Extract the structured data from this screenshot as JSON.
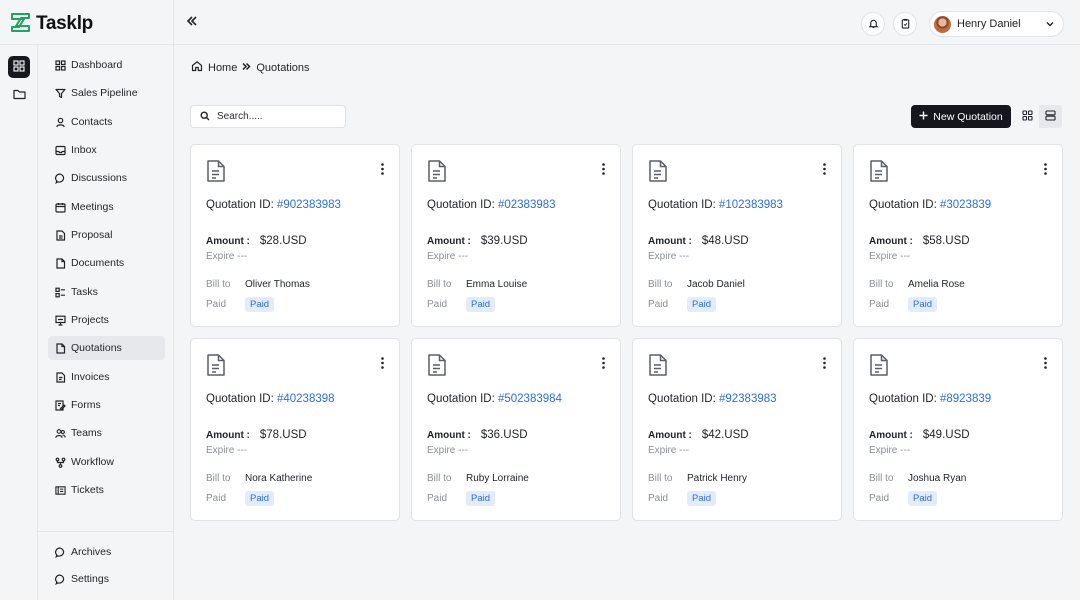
{
  "app": {
    "name": "Tasklp"
  },
  "header": {
    "user_name": "Henry Daniel"
  },
  "sidebar": {
    "items": [
      {
        "label": "Dashboard"
      },
      {
        "label": "Sales Pipeline"
      },
      {
        "label": "Contacts"
      },
      {
        "label": "Inbox"
      },
      {
        "label": "Discussions"
      },
      {
        "label": "Meetings"
      },
      {
        "label": "Proposal"
      },
      {
        "label": "Documents"
      },
      {
        "label": "Tasks"
      },
      {
        "label": "Projects"
      },
      {
        "label": "Quotations"
      },
      {
        "label": "Invoices"
      },
      {
        "label": "Forms"
      },
      {
        "label": "Teams"
      },
      {
        "label": "Workflow"
      },
      {
        "label": "Tickets"
      }
    ],
    "bottom": [
      {
        "label": "Archives"
      },
      {
        "label": "Settings"
      }
    ]
  },
  "breadcrumb": {
    "home": "Home",
    "current": "Quotations"
  },
  "toolbar": {
    "search_placeholder": "Search.....",
    "new_label": "New Quotation"
  },
  "labels": {
    "quotation_id": "Quotation ID: ",
    "amount": "Amount :",
    "expire": "Expire ---",
    "bill_to": "Bill to",
    "paid": "Paid",
    "paid_badge": "Paid"
  },
  "quotations": [
    {
      "id": "#902383983",
      "amount": "$28.USD",
      "bill_to": "Oliver Thomas"
    },
    {
      "id": "#02383983",
      "amount": "$39.USD",
      "bill_to": "Emma Louise"
    },
    {
      "id": "#102383983",
      "amount": "$48.USD",
      "bill_to": "Jacob Daniel"
    },
    {
      "id": "#3023839",
      "amount": "$58.USD",
      "bill_to": "Amelia Rose"
    },
    {
      "id": "#40238398",
      "amount": "$78.USD",
      "bill_to": "Nora Katherine"
    },
    {
      "id": "#502383984",
      "amount": "$36.USD",
      "bill_to": "Ruby Lorraine"
    },
    {
      "id": "#92383983",
      "amount": "$42.USD",
      "bill_to": "Patrick Henry"
    },
    {
      "id": "#8923839",
      "amount": "$49.USD",
      "bill_to": "Joshua Ryan"
    }
  ],
  "colors": {
    "accent": "#2c6fd7",
    "primary_button": "#15171c",
    "badge_bg": "#e3ecfb",
    "logo_green": "#1fa463"
  }
}
